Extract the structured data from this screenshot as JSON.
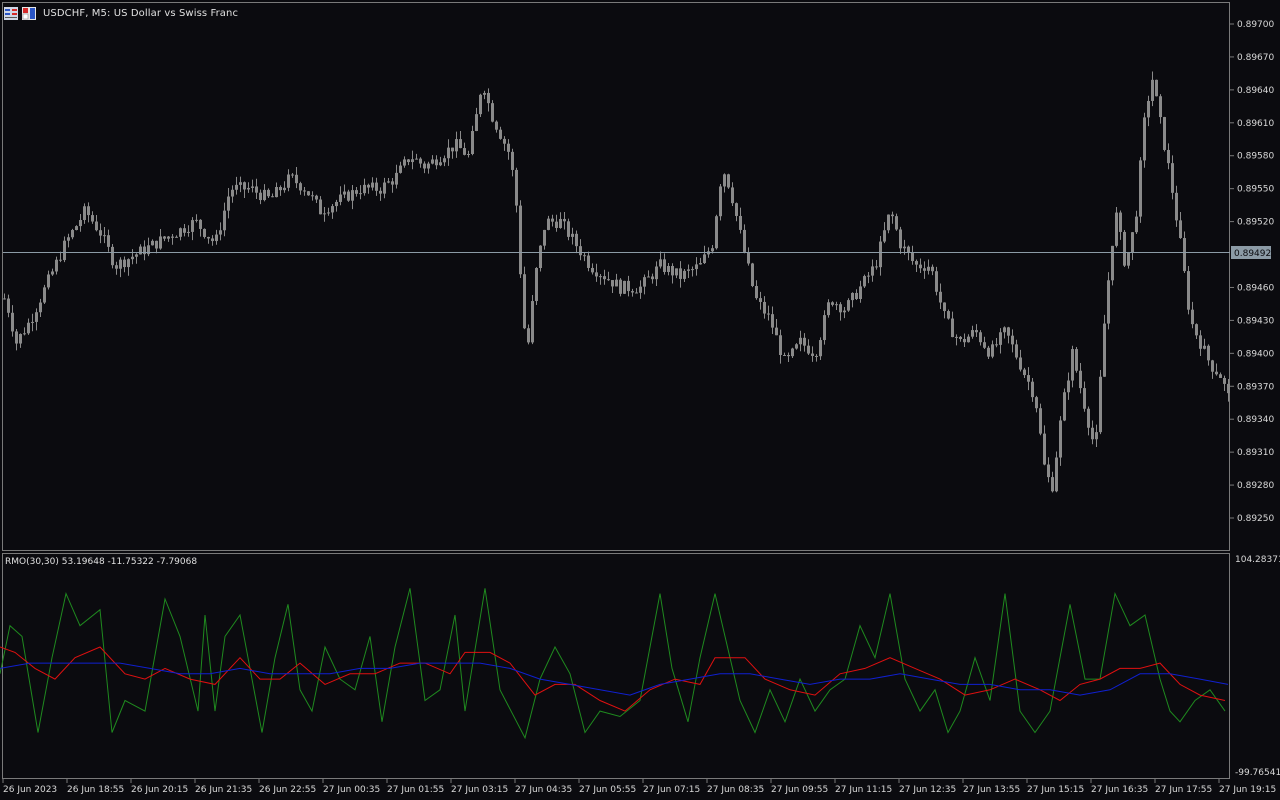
{
  "header": {
    "symbol_label": "USDCHF, M5:  US Dollar vs Swiss Franc"
  },
  "price_axis": {
    "labels": [
      "0.89700",
      "0.89670",
      "0.89640",
      "0.89610",
      "0.89580",
      "0.89550",
      "0.89520",
      "0.89460",
      "0.89430",
      "0.89400",
      "0.89370",
      "0.89340",
      "0.89310",
      "0.89280",
      "0.89250"
    ],
    "current_price": "0.89492"
  },
  "indicator": {
    "label": "RMO(30,30) 53.19648 -11.75322 -7.79068",
    "scale_max": "104.28371",
    "scale_min": "-99.76541"
  },
  "time_axis": {
    "labels": [
      "26 Jun 2023",
      "26 Jun 18:55",
      "26 Jun 20:15",
      "26 Jun 21:35",
      "26 Jun 22:55",
      "27 Jun 00:35",
      "27 Jun 01:55",
      "27 Jun 03:15",
      "27 Jun 04:35",
      "27 Jun 05:55",
      "27 Jun 07:15",
      "27 Jun 08:35",
      "27 Jun 09:55",
      "27 Jun 11:15",
      "27 Jun 12:35",
      "27 Jun 13:55",
      "27 Jun 15:15",
      "27 Jun 16:35",
      "27 Jun 17:55",
      "27 Jun 19:15"
    ]
  },
  "colors": {
    "background": "#0b0b0f",
    "candle": "#8a8a8a",
    "grid_border": "#7a7a7a",
    "bid_line": "#8c9ba6",
    "rmo_line": "#1f8a1f",
    "signal_line": "#e01010",
    "main_line": "#1020d0"
  },
  "chart_data": {
    "type": "candlestick",
    "symbol": "USDCHF",
    "timeframe": "M5",
    "ylim": [
      0.8923,
      0.8972
    ],
    "price_path": [
      [
        0,
        0.8946
      ],
      [
        8,
        0.8944
      ],
      [
        16,
        0.8941
      ],
      [
        30,
        0.8943
      ],
      [
        45,
        0.8946
      ],
      [
        65,
        0.895
      ],
      [
        85,
        0.8953
      ],
      [
        100,
        0.8951
      ],
      [
        115,
        0.8948
      ],
      [
        135,
        0.8949
      ],
      [
        155,
        0.895
      ],
      [
        175,
        0.8951
      ],
      [
        195,
        0.8952
      ],
      [
        215,
        0.895
      ],
      [
        230,
        0.8955
      ],
      [
        250,
        0.8955
      ],
      [
        270,
        0.8954
      ],
      [
        290,
        0.8956
      ],
      [
        305,
        0.8955
      ],
      [
        320,
        0.8953
      ],
      [
        340,
        0.8954
      ],
      [
        360,
        0.8955
      ],
      [
        380,
        0.8955
      ],
      [
        395,
        0.8956
      ],
      [
        410,
        0.8958
      ],
      [
        425,
        0.8957
      ],
      [
        440,
        0.8958
      ],
      [
        455,
        0.8959
      ],
      [
        468,
        0.8958
      ],
      [
        475,
        0.8961
      ],
      [
        482,
        0.8965
      ],
      [
        490,
        0.8962
      ],
      [
        500,
        0.896
      ],
      [
        510,
        0.8958
      ],
      [
        518,
        0.8952
      ],
      [
        522,
        0.8943
      ],
      [
        528,
        0.8941
      ],
      [
        535,
        0.8947
      ],
      [
        545,
        0.8952
      ],
      [
        560,
        0.8952
      ],
      [
        575,
        0.895
      ],
      [
        590,
        0.8948
      ],
      [
        605,
        0.8947
      ],
      [
        620,
        0.8946
      ],
      [
        640,
        0.8946
      ],
      [
        660,
        0.8948
      ],
      [
        680,
        0.8947
      ],
      [
        700,
        0.8948
      ],
      [
        712,
        0.895
      ],
      [
        722,
        0.8957
      ],
      [
        730,
        0.8955
      ],
      [
        742,
        0.895
      ],
      [
        755,
        0.8945
      ],
      [
        770,
        0.8943
      ],
      [
        785,
        0.8939
      ],
      [
        800,
        0.8941
      ],
      [
        815,
        0.894
      ],
      [
        830,
        0.8945
      ],
      [
        845,
        0.8944
      ],
      [
        860,
        0.8946
      ],
      [
        875,
        0.8948
      ],
      [
        890,
        0.8953
      ],
      [
        900,
        0.895
      ],
      [
        915,
        0.8948
      ],
      [
        930,
        0.8948
      ],
      [
        945,
        0.8943
      ],
      [
        960,
        0.8941
      ],
      [
        975,
        0.8942
      ],
      [
        990,
        0.894
      ],
      [
        1005,
        0.8942
      ],
      [
        1020,
        0.8939
      ],
      [
        1035,
        0.8936
      ],
      [
        1045,
        0.8929
      ],
      [
        1052,
        0.8928
      ],
      [
        1062,
        0.8935
      ],
      [
        1072,
        0.894
      ],
      [
        1085,
        0.8935
      ],
      [
        1095,
        0.8931
      ],
      [
        1105,
        0.8944
      ],
      [
        1115,
        0.8953
      ],
      [
        1125,
        0.8948
      ],
      [
        1135,
        0.8952
      ],
      [
        1145,
        0.8962
      ],
      [
        1152,
        0.8965
      ],
      [
        1160,
        0.8961
      ],
      [
        1170,
        0.8956
      ],
      [
        1180,
        0.895
      ],
      [
        1190,
        0.8943
      ],
      [
        1200,
        0.8941
      ],
      [
        1210,
        0.8939
      ],
      [
        1220,
        0.8938
      ],
      [
        1228,
        0.8936
      ]
    ],
    "indicator": {
      "name": "RMO",
      "params": [
        30,
        30
      ],
      "values": [
        53.19648,
        -11.75322,
        -7.79068
      ],
      "ylim": [
        -99.76541,
        104.28371
      ],
      "series": [
        {
          "color": "#1f8a1f",
          "path": [
            [
              0,
              -5
            ],
            [
              10,
              40
            ],
            [
              22,
              30
            ],
            [
              38,
              -60
            ],
            [
              52,
              10
            ],
            [
              66,
              70
            ],
            [
              80,
              40
            ],
            [
              100,
              55
            ],
            [
              112,
              -60
            ],
            [
              125,
              -30
            ],
            [
              145,
              -40
            ],
            [
              165,
              65
            ],
            [
              180,
              30
            ],
            [
              198,
              -40
            ],
            [
              205,
              50
            ],
            [
              215,
              -40
            ],
            [
              225,
              30
            ],
            [
              240,
              50
            ],
            [
              262,
              -60
            ],
            [
              275,
              10
            ],
            [
              288,
              60
            ],
            [
              300,
              -20
            ],
            [
              312,
              -40
            ],
            [
              325,
              20
            ],
            [
              340,
              -10
            ],
            [
              355,
              -20
            ],
            [
              370,
              30
            ],
            [
              382,
              -50
            ],
            [
              395,
              20
            ],
            [
              410,
              75
            ],
            [
              425,
              -30
            ],
            [
              440,
              -20
            ],
            [
              455,
              50
            ],
            [
              465,
              -40
            ],
            [
              485,
              75
            ],
            [
              500,
              -20
            ],
            [
              525,
              -65
            ],
            [
              540,
              -10
            ],
            [
              555,
              20
            ],
            [
              570,
              -5
            ],
            [
              585,
              -60
            ],
            [
              600,
              -40
            ],
            [
              620,
              -45
            ],
            [
              640,
              -30
            ],
            [
              660,
              70
            ],
            [
              672,
              0
            ],
            [
              688,
              -50
            ],
            [
              700,
              10
            ],
            [
              715,
              70
            ],
            [
              725,
              30
            ],
            [
              740,
              -30
            ],
            [
              755,
              -60
            ],
            [
              770,
              -20
            ],
            [
              785,
              -50
            ],
            [
              800,
              -10
            ],
            [
              815,
              -40
            ],
            [
              830,
              -20
            ],
            [
              845,
              -10
            ],
            [
              860,
              40
            ],
            [
              875,
              10
            ],
            [
              890,
              70
            ],
            [
              905,
              -10
            ],
            [
              920,
              -40
            ],
            [
              935,
              -20
            ],
            [
              948,
              -60
            ],
            [
              960,
              -40
            ],
            [
              975,
              10
            ],
            [
              990,
              -30
            ],
            [
              1005,
              70
            ],
            [
              1020,
              -40
            ],
            [
              1035,
              -60
            ],
            [
              1050,
              -40
            ],
            [
              1070,
              60
            ],
            [
              1085,
              -10
            ],
            [
              1100,
              -10
            ],
            [
              1115,
              70
            ],
            [
              1130,
              40
            ],
            [
              1145,
              50
            ],
            [
              1160,
              -10
            ],
            [
              1170,
              -40
            ],
            [
              1180,
              -50
            ],
            [
              1195,
              -30
            ],
            [
              1210,
              -20
            ],
            [
              1225,
              -40
            ]
          ]
        },
        {
          "color": "#e01010",
          "path": [
            [
              0,
              20
            ],
            [
              15,
              15
            ],
            [
              35,
              0
            ],
            [
              55,
              -10
            ],
            [
              75,
              10
            ],
            [
              100,
              20
            ],
            [
              125,
              -5
            ],
            [
              145,
              -10
            ],
            [
              165,
              0
            ],
            [
              190,
              -10
            ],
            [
              215,
              -15
            ],
            [
              240,
              10
            ],
            [
              260,
              -10
            ],
            [
              280,
              -10
            ],
            [
              300,
              5
            ],
            [
              325,
              -15
            ],
            [
              350,
              -5
            ],
            [
              375,
              -5
            ],
            [
              400,
              5
            ],
            [
              425,
              5
            ],
            [
              450,
              -5
            ],
            [
              465,
              15
            ],
            [
              490,
              15
            ],
            [
              510,
              5
            ],
            [
              535,
              -25
            ],
            [
              555,
              -15
            ],
            [
              575,
              -15
            ],
            [
              600,
              -30
            ],
            [
              625,
              -40
            ],
            [
              650,
              -20
            ],
            [
              675,
              -10
            ],
            [
              700,
              -15
            ],
            [
              715,
              10
            ],
            [
              730,
              10
            ],
            [
              745,
              10
            ],
            [
              765,
              -10
            ],
            [
              790,
              -20
            ],
            [
              815,
              -25
            ],
            [
              840,
              -5
            ],
            [
              865,
              0
            ],
            [
              890,
              10
            ],
            [
              915,
              0
            ],
            [
              940,
              -10
            ],
            [
              965,
              -25
            ],
            [
              990,
              -20
            ],
            [
              1015,
              -10
            ],
            [
              1040,
              -20
            ],
            [
              1060,
              -30
            ],
            [
              1080,
              -15
            ],
            [
              1100,
              -10
            ],
            [
              1120,
              0
            ],
            [
              1140,
              0
            ],
            [
              1160,
              5
            ],
            [
              1180,
              -15
            ],
            [
              1200,
              -25
            ],
            [
              1225,
              -30
            ]
          ]
        },
        {
          "color": "#1020d0",
          "path": [
            [
              0,
              0
            ],
            [
              30,
              5
            ],
            [
              60,
              5
            ],
            [
              90,
              5
            ],
            [
              120,
              5
            ],
            [
              150,
              0
            ],
            [
              180,
              -5
            ],
            [
              210,
              -5
            ],
            [
              240,
              0
            ],
            [
              270,
              -5
            ],
            [
              300,
              -5
            ],
            [
              330,
              -5
            ],
            [
              360,
              0
            ],
            [
              390,
              0
            ],
            [
              420,
              5
            ],
            [
              450,
              5
            ],
            [
              480,
              5
            ],
            [
              510,
              0
            ],
            [
              540,
              -10
            ],
            [
              570,
              -15
            ],
            [
              600,
              -20
            ],
            [
              630,
              -25
            ],
            [
              660,
              -15
            ],
            [
              690,
              -10
            ],
            [
              720,
              -5
            ],
            [
              750,
              -5
            ],
            [
              780,
              -10
            ],
            [
              810,
              -15
            ],
            [
              840,
              -10
            ],
            [
              870,
              -10
            ],
            [
              900,
              -5
            ],
            [
              930,
              -10
            ],
            [
              960,
              -15
            ],
            [
              990,
              -15
            ],
            [
              1020,
              -20
            ],
            [
              1050,
              -20
            ],
            [
              1080,
              -25
            ],
            [
              1110,
              -20
            ],
            [
              1140,
              -5
            ],
            [
              1170,
              -5
            ],
            [
              1200,
              -10
            ],
            [
              1228,
              -15
            ]
          ]
        }
      ]
    }
  }
}
